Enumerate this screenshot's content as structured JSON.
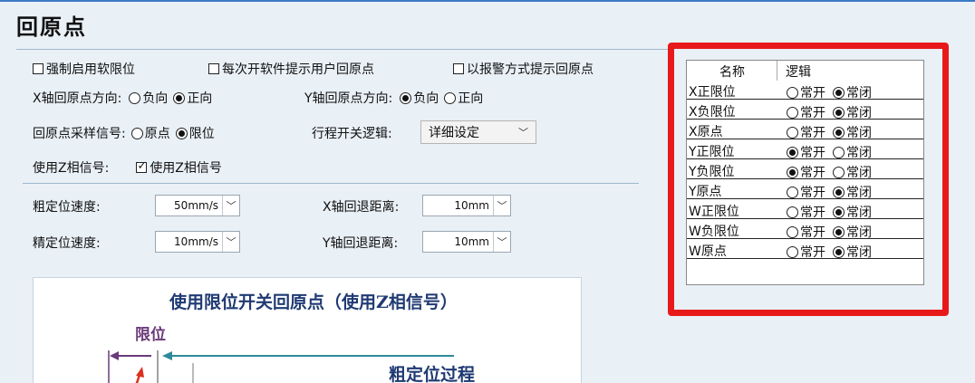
{
  "title": "回原点",
  "options": {
    "force_soft_limit": {
      "label": "强制启用软限位",
      "checked": false
    },
    "prompt_home_on_start": {
      "label": "每次开软件提示用户回原点",
      "checked": false
    },
    "alarm_prompt_home": {
      "label": "以报警方式提示回原点",
      "checked": false
    }
  },
  "x_home_dir": {
    "label": "X轴回原点方向:",
    "options": [
      "负向",
      "正向"
    ],
    "selected": "正向"
  },
  "y_home_dir": {
    "label": "Y轴回原点方向:",
    "options": [
      "负向",
      "正向"
    ],
    "selected": "负向"
  },
  "home_signal": {
    "label": "回原点采样信号:",
    "options": [
      "原点",
      "限位"
    ],
    "selected": "限位"
  },
  "switch_logic": {
    "label": "行程开关逻辑:",
    "value": "详细设定"
  },
  "z_signal": {
    "label": "使用Z相信号:",
    "checkbox_label": "使用Z相信号",
    "checked": true
  },
  "coarse_speed": {
    "label": "粗定位速度:",
    "value": "50mm/s"
  },
  "fine_speed": {
    "label": "精定位速度:",
    "value": "10mm/s"
  },
  "x_back": {
    "label": "X轴回退距离:",
    "value": "10mm"
  },
  "y_back": {
    "label": "Y轴回退距离:",
    "value": "10mm"
  },
  "diagram": {
    "title": "使用限位开关回原点（使用Z相信号）",
    "limit_label": "限位",
    "coarse_label": "粗定位过程"
  },
  "logic_table": {
    "headers": {
      "name": "名称",
      "logic": "逻辑"
    },
    "option_labels": [
      "常开",
      "常闭"
    ],
    "rows": [
      {
        "name": "X正限位",
        "selected": "常闭"
      },
      {
        "name": "X负限位",
        "selected": "常闭"
      },
      {
        "name": "X原点",
        "selected": "常闭"
      },
      {
        "name": "Y正限位",
        "selected": "常开"
      },
      {
        "name": "Y负限位",
        "selected": "常开"
      },
      {
        "name": "Y原点",
        "selected": "常闭"
      },
      {
        "name": "W正限位",
        "selected": "常闭"
      },
      {
        "name": "W负限位",
        "selected": "常闭"
      },
      {
        "name": "W原点",
        "selected": "常闭"
      }
    ]
  },
  "colors": {
    "highlight": "#e8191b",
    "diagram_title": "#1f3a73",
    "limit_label": "#6a3a7a",
    "arrow_teal": "#2e8a9a",
    "arrow_purple": "#6a3a7a",
    "arrow_red": "#d9321f"
  }
}
